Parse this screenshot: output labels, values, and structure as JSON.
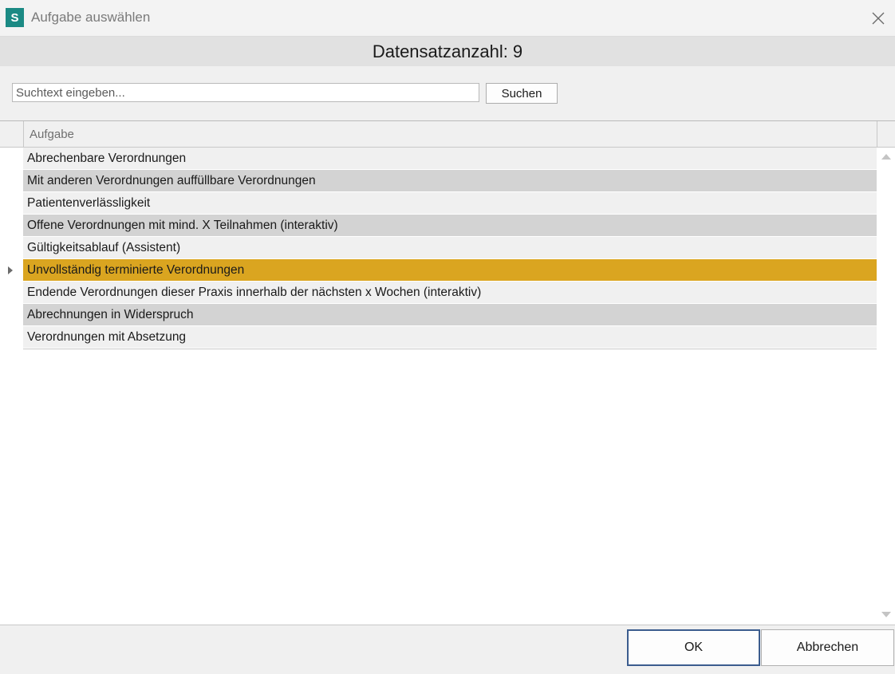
{
  "window": {
    "app_icon_letter": "S",
    "title": "Aufgabe auswählen"
  },
  "header": {
    "record_count_text": "Datensatzanzahl: 9"
  },
  "search": {
    "placeholder": "Suchtext eingeben...",
    "value": "",
    "button_label": "Suchen"
  },
  "grid": {
    "column_header": "Aufgabe",
    "rows": [
      {
        "label": "Abrechenbare Verordnungen",
        "selected": false
      },
      {
        "label": "Mit anderen Verordnungen auffüllbare Verordnungen",
        "selected": false
      },
      {
        "label": "Patientenverlässligkeit",
        "selected": false
      },
      {
        "label": "Offene Verordnungen mit mind. X Teilnahmen (interaktiv)",
        "selected": false
      },
      {
        "label": "Gültigkeitsablauf (Assistent)",
        "selected": false
      },
      {
        "label": "Unvollständig terminierte Verordnungen",
        "selected": true
      },
      {
        "label": "Endende Verordnungen dieser Praxis innerhalb der nächsten x Wochen (interaktiv)",
        "selected": false
      },
      {
        "label": "Abrechnungen in Widerspruch",
        "selected": false
      },
      {
        "label": "Verordnungen mit Absetzung",
        "selected": false
      }
    ]
  },
  "footer": {
    "ok_label": "OK",
    "cancel_label": "Abbrechen"
  },
  "colors": {
    "app_icon": "#1b8a84",
    "selected_row": "#daa520",
    "alt_row": "#d3d3d3",
    "ok_border": "#3b5c8e"
  },
  "icons": {
    "close": "close-icon",
    "row_pointer": "row-pointer-icon",
    "scroll_up": "scroll-up-arrow-icon",
    "scroll_down": "scroll-down-arrow-icon"
  }
}
